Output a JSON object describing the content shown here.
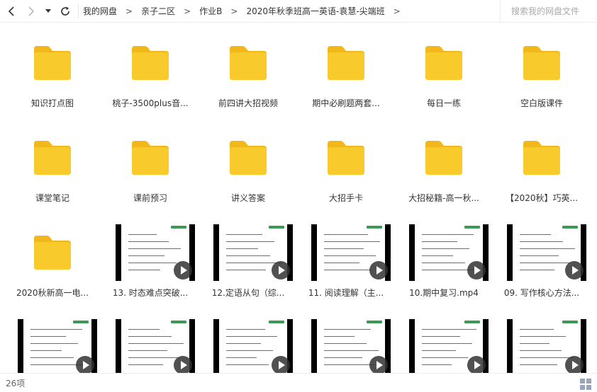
{
  "toolbar": {
    "breadcrumbs": [
      "我的网盘",
      "亲子二区",
      "作业B",
      "2020年秋季班高一英语-袁慧-尖端班"
    ],
    "search_placeholder": "搜索我的网盘文件"
  },
  "folders_row1": [
    "知识打点图",
    "桃子-3500plus音...",
    "前四讲大招视频",
    "期中必刷题两套...",
    "每日一练",
    "空白版课件"
  ],
  "folders_row2": [
    "课堂笔记",
    "课前预习",
    "讲义答案",
    "大招手卡",
    "大招秘籍-高一秋...",
    "【2020秋】巧英..."
  ],
  "row3": {
    "folder": "2020秋新高一电...",
    "videos": [
      "13. 时态难点突破...",
      "12.定语从句（综...",
      "11. 阅读理解（主...",
      "10.期中复习.mp4",
      "09. 写作核心方法..."
    ]
  },
  "row4_videos": [
    "",
    "",
    "",
    "",
    "",
    ""
  ],
  "status": {
    "count": "26项"
  },
  "colors": {
    "folder": "#f9ca2c",
    "folder_tab": "#f2b81b"
  }
}
